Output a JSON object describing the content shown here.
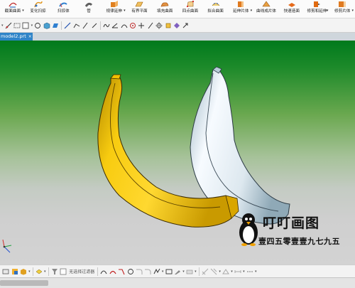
{
  "ribbon": {
    "items": [
      {
        "label": "截面曲面",
        "icon": "section-surface-icon",
        "caret": true
      },
      {
        "label": "变化扫掠",
        "icon": "variational-sweep-icon",
        "caret": false
      },
      {
        "label": "扫掠体",
        "icon": "swept-icon",
        "caret": false
      },
      {
        "label": "管",
        "icon": "tube-icon",
        "caret": false
      },
      {
        "label": "规律延伸",
        "icon": "law-extension-icon",
        "caret": true
      },
      {
        "label": "有界平面",
        "icon": "bounded-plane-icon",
        "caret": false
      },
      {
        "label": "填充曲面",
        "icon": "fill-surface-icon",
        "caret": false
      },
      {
        "label": "四点曲面",
        "icon": "four-point-surface-icon",
        "caret": false
      },
      {
        "label": "拟合曲面",
        "icon": "fit-surface-icon",
        "caret": false
      },
      {
        "label": "延伸片体",
        "icon": "extend-sheet-icon",
        "caret": true
      },
      {
        "label": "曲线成片体",
        "icon": "curve-to-sheet-icon",
        "caret": false
      },
      {
        "label": "快速造面",
        "icon": "rapid-surfacing-icon",
        "caret": false
      },
      {
        "label": "修剪和延伸",
        "icon": "trim-extend-icon",
        "caret": true
      },
      {
        "label": "修剪片体",
        "icon": "trim-sheet-icon",
        "caret": true
      }
    ]
  },
  "file_tab": {
    "label": "model2.prt",
    "close": "×"
  },
  "bottom_toolbar": {
    "label": "无选择过滤器"
  },
  "watermark": {
    "title": "叮叮画图",
    "subtitle": "壹四五零壹壹九七九五"
  },
  "colors": {
    "ribbon_bg": "#fbfbfb",
    "tab_active": "#2f84c8",
    "viewport_top": "#007a1c",
    "viewport_bottom": "#d3d3d3",
    "banana_yellow": "#f2c200",
    "banana_white": "#e6eef2"
  }
}
